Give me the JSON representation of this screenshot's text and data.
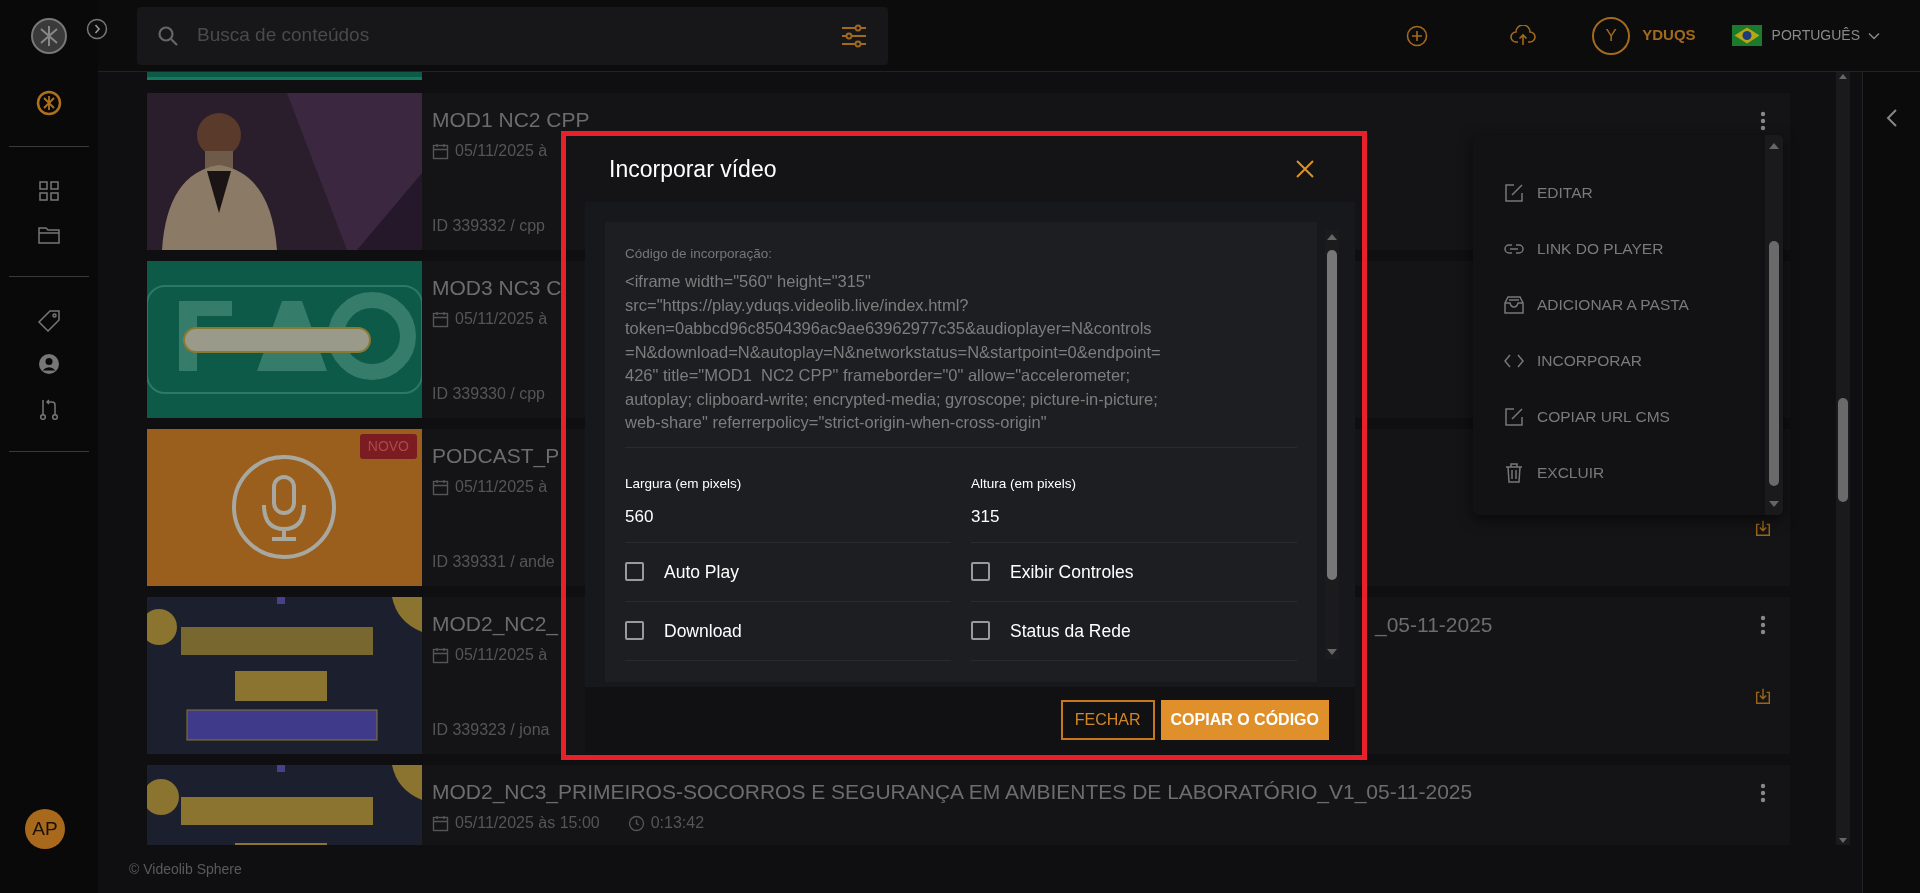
{
  "search": {
    "placeholder": "Busca de conteúdos"
  },
  "user": {
    "initial": "Y",
    "name": "YDUQS"
  },
  "language": {
    "label": "PORTUGUÊS"
  },
  "account": {
    "initials": "AP"
  },
  "videos": [
    {
      "title": "MOD1 NC2 CPP",
      "date": "05/11/2025 à",
      "id_line": "ID 339332 / cpp",
      "menu_button": true,
      "download_button": false
    },
    {
      "title": "MOD3 NC3 C",
      "date": "05/11/2025 à",
      "id_line": "ID 339330 / cpp",
      "menu_button": false,
      "download_button": false
    },
    {
      "title": "PODCAST_P",
      "date": "05/11/2025 à",
      "id_line": "ID 339331 / ande",
      "badge": "NOVO",
      "menu_button": false,
      "download_button": true
    },
    {
      "title": "MOD2_NC2_",
      "title_tail": "_05-11-2025",
      "date": "05/11/2025 à",
      "id_line": "ID 339323 / jona",
      "menu_button": true,
      "download_button": true
    },
    {
      "title": "MOD2_NC3_PRIMEIROS-SOCORROS E SEGURANÇA EM AMBIENTES DE LABORATÓRIO_V1_05-11-2025",
      "date": "05/11/2025 às 15:00",
      "duration": "0:13:42",
      "menu_button": true,
      "download_button": false
    }
  ],
  "menu": {
    "items": [
      {
        "label": "EDITAR",
        "kind": "edit"
      },
      {
        "label": "LINK DO PLAYER",
        "kind": "link"
      },
      {
        "label": "ADICIONAR A PASTA",
        "kind": "folder"
      },
      {
        "label": "INCORPORAR",
        "kind": "code"
      },
      {
        "label": "COPIAR URL CMS",
        "kind": "edit"
      },
      {
        "label": "EXCLUIR",
        "kind": "trash"
      }
    ]
  },
  "modal": {
    "title": "Incorporar vídeo",
    "code_label": "Código de incorporação:",
    "code": "<iframe width=\"560\" height=\"315\"\nsrc=\"https://play.yduqs.videolib.live/index.html?\ntoken=0abbcd96c8504396ac9ae63962977c35&audioplayer=N&controls\n=N&download=N&autoplay=N&networkstatus=N&startpoint=0&endpoint=\n426\" title=\"MOD1  NC2 CPP\" frameborder=\"0\" allow=\"accelerometer;\nautoplay; clipboard-write; encrypted-media; gyroscope; picture-in-picture;\nweb-share\" referrerpolicy=\"strict-origin-when-cross-origin\"",
    "fields": [
      {
        "label": "Largura (em pixels)",
        "value": "560"
      },
      {
        "label": "Altura (em pixels)",
        "value": "315"
      }
    ],
    "options": [
      {
        "label": "Auto Play",
        "checked": false
      },
      {
        "label": "Exibir Controles",
        "checked": false
      },
      {
        "label": "Download",
        "checked": false
      },
      {
        "label": "Status da Rede",
        "checked": false
      }
    ],
    "buttons": [
      {
        "label": "FECHAR",
        "kind": "outline"
      },
      {
        "label": "COPIAR O CÓDIGO",
        "kind": "primary"
      }
    ]
  },
  "footer": "© Videolib Sphere"
}
